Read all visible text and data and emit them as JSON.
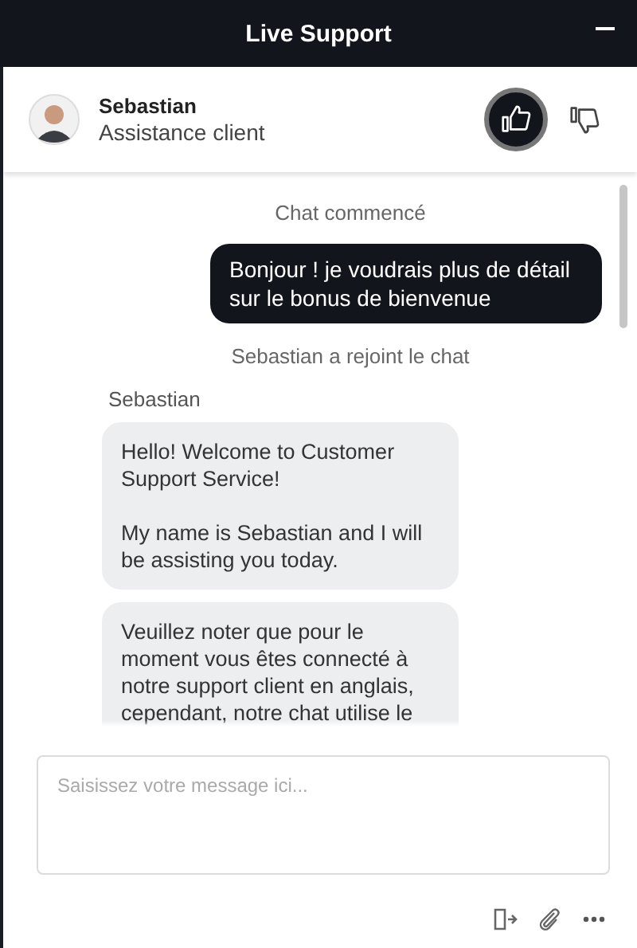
{
  "window": {
    "title": "Live Support"
  },
  "agent": {
    "name": "Sebastian",
    "role": "Assistance client"
  },
  "rating": [
    {
      "kind": "up",
      "selected": true
    },
    {
      "kind": "down",
      "selected": false
    }
  ],
  "messages": [
    {
      "kind": "system",
      "text": "Chat commencé"
    },
    {
      "kind": "user",
      "text": "Bonjour ! je voudrais plus de détail sur le bonus de bienvenue"
    },
    {
      "kind": "system",
      "text": "Sebastian a rejoint le chat"
    },
    {
      "kind": "sender",
      "text": "Sebastian"
    },
    {
      "kind": "agent",
      "text": "Hello! Welcome to Customer Support Service!\n\nMy name is Sebastian and I will be assisting you today."
    },
    {
      "kind": "agent",
      "text": "Veuillez noter que pour le moment vous êtes connecté à notre support client en anglais, cependant, notre chat utilise le"
    }
  ],
  "composer": {
    "placeholder": "Saisissez votre message ici..."
  }
}
